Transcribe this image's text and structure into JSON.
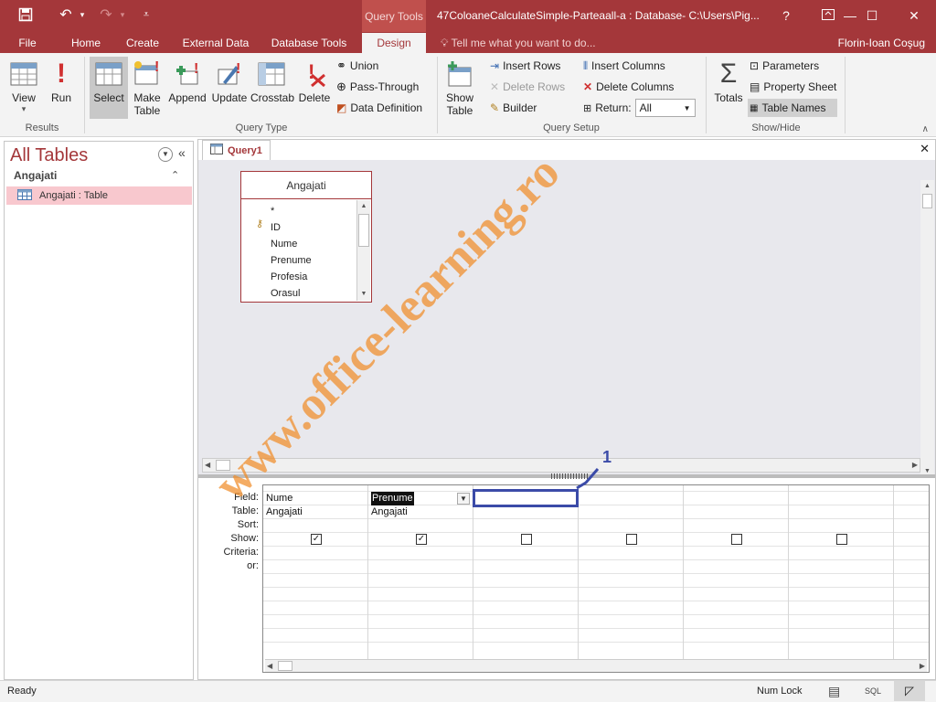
{
  "window": {
    "title": "47ColoaneCalculateSimple-Parteaall-a : Database- C:\\Users\\Pig...",
    "context_tab": "Query Tools",
    "help": "?",
    "user": "Florin-Ioan Coşug"
  },
  "tabs": [
    "File",
    "Home",
    "Create",
    "External Data",
    "Database Tools",
    "Design"
  ],
  "tell_me": "Tell me what you want to do...",
  "ribbon": {
    "results": {
      "label": "Results",
      "view": "View",
      "run": "Run"
    },
    "query_type": {
      "label": "Query Type",
      "select": "Select",
      "make_table_1": "Make",
      "make_table_2": "Table",
      "append": "Append",
      "update": "Update",
      "crosstab": "Crosstab",
      "delete": "Delete",
      "union": "Union",
      "pass_through": "Pass-Through",
      "data_definition": "Data Definition"
    },
    "query_setup": {
      "label": "Query Setup",
      "show_table_1": "Show",
      "show_table_2": "Table",
      "insert_rows": "Insert Rows",
      "delete_rows": "Delete Rows",
      "builder": "Builder",
      "insert_columns": "Insert Columns",
      "delete_columns": "Delete Columns",
      "return_label": "Return:",
      "return_value": "All"
    },
    "show_hide": {
      "label": "Show/Hide",
      "totals": "Totals",
      "parameters": "Parameters",
      "property_sheet": "Property Sheet",
      "table_names": "Table Names"
    }
  },
  "nav": {
    "title": "All Tables",
    "group": "Angajati",
    "item": "Angajati : Table"
  },
  "document": {
    "tab": "Query1",
    "table": {
      "name": "Angajati",
      "fields": [
        "*",
        "ID",
        "Nume",
        "Prenume",
        "Profesia",
        "Orasul"
      ]
    },
    "annotation": "1",
    "grid": {
      "row_labels": [
        "Field:",
        "Table:",
        "Sort:",
        "Show:",
        "Criteria:",
        "or:"
      ],
      "columns": [
        {
          "field": "Nume",
          "table": "Angajati",
          "show": true
        },
        {
          "field": "Prenume",
          "table": "Angajati",
          "show": true
        },
        {
          "field": "",
          "table": "",
          "show": false
        },
        {
          "field": "",
          "table": "",
          "show": false
        },
        {
          "field": "",
          "table": "",
          "show": false
        },
        {
          "field": "",
          "table": "",
          "show": false
        }
      ]
    }
  },
  "status": {
    "ready": "Ready",
    "numlock": "Num Lock",
    "sql": "SQL"
  },
  "watermark": "www.office-learning.ro",
  "colors": {
    "accent": "#a4373a",
    "highlight": "#3b4ba8",
    "watermark": "#f08c28"
  }
}
